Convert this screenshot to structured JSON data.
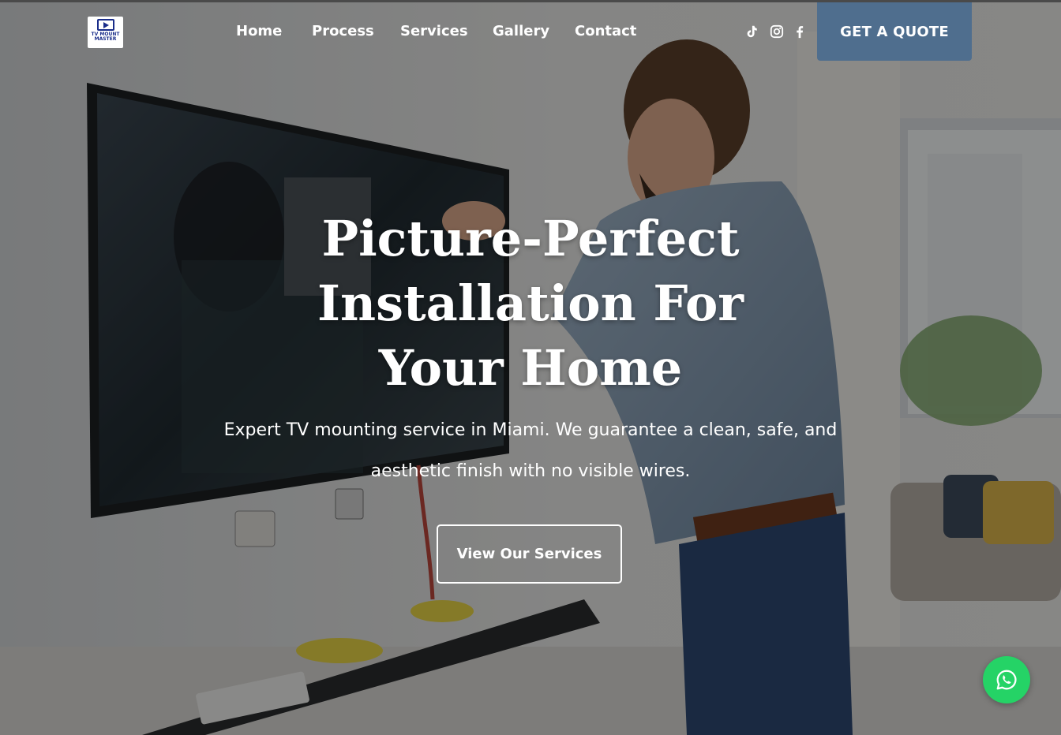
{
  "brand": {
    "logo_text": "TV MOUNT MASTER",
    "accent": "#4f6e8e",
    "whatsapp_green": "#25d366"
  },
  "nav": {
    "items": [
      {
        "label": "Home"
      },
      {
        "label": "Process"
      },
      {
        "label": "Services"
      },
      {
        "label": "Gallery"
      },
      {
        "label": "Contact"
      }
    ]
  },
  "social": {
    "icons": [
      "tiktok-icon",
      "instagram-icon",
      "facebook-icon"
    ]
  },
  "header": {
    "quote_label": "GET A QUOTE"
  },
  "hero": {
    "headline": "Picture-Perfect Installation For Your Home",
    "subtext": "Expert TV mounting service in Miami. We guarantee a clean, safe, and aesthetic finish with no visible wires.",
    "cta_label": "View Our Services"
  },
  "floating": {
    "icon": "whatsapp-icon"
  }
}
